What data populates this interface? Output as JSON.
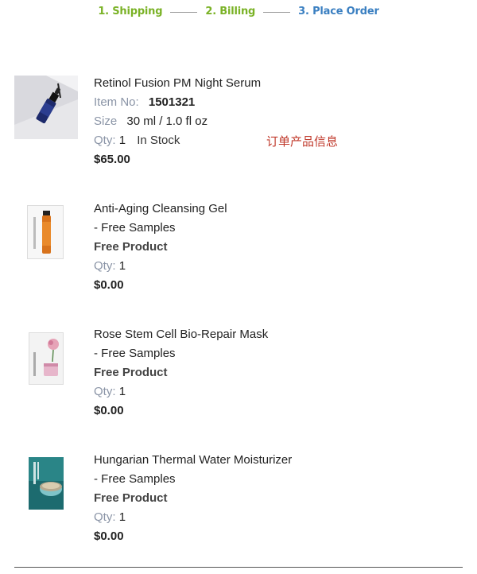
{
  "steps": [
    {
      "label": "1. Shipping",
      "state": "done"
    },
    {
      "label": "2. Billing",
      "state": "done"
    },
    {
      "label": "3. Place Order",
      "state": "current"
    }
  ],
  "colors": {
    "step_done": "#7ab226",
    "step_current": "#3a7fc1",
    "label_grey": "#8a94a6",
    "annotation_red": "#c0392b"
  },
  "annotation": "订单产品信息",
  "products": [
    {
      "name": "Retinol Fusion PM Night Serum",
      "item_label": "Item No:",
      "item_no": "1501321",
      "size_label": "Size",
      "size": "30 ml / 1.0 fl oz",
      "qty_label": "Qty:",
      "qty": "1",
      "stock": "In Stock",
      "price": "$65.00",
      "image_icon": "serum-bottle-image"
    },
    {
      "name": "Anti-Aging Cleansing Gel",
      "sub": "- Free Samples",
      "free": "Free Product",
      "qty_label": "Qty:",
      "qty": "1",
      "price": "$0.00",
      "image_icon": "cleansing-gel-sachet-image"
    },
    {
      "name": "Rose Stem Cell Bio-Repair Mask",
      "sub": "- Free Samples",
      "free": "Free Product",
      "qty_label": "Qty:",
      "qty": "1",
      "price": "$0.00",
      "image_icon": "mask-sachet-image"
    },
    {
      "name": "Hungarian Thermal Water Moisturizer",
      "sub": "- Free Samples",
      "free": "Free Product",
      "qty_label": "Qty:",
      "qty": "1",
      "price": "$0.00",
      "image_icon": "moisturizer-sachet-image"
    }
  ]
}
